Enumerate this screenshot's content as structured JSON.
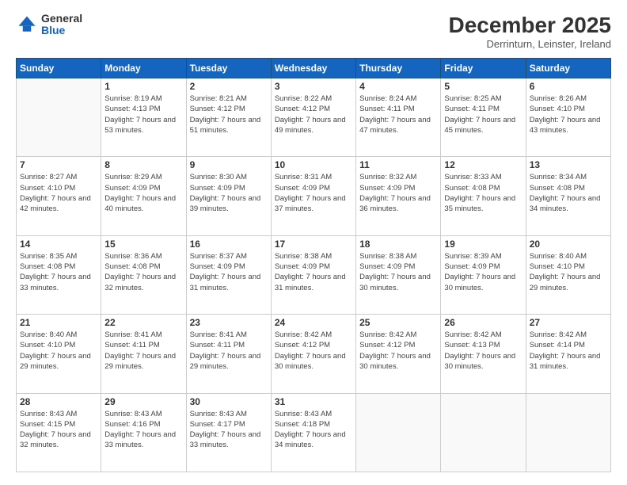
{
  "logo": {
    "general": "General",
    "blue": "Blue"
  },
  "header": {
    "title": "December 2025",
    "subtitle": "Derrinturn, Leinster, Ireland"
  },
  "weekdays": [
    "Sunday",
    "Monday",
    "Tuesday",
    "Wednesday",
    "Thursday",
    "Friday",
    "Saturday"
  ],
  "weeks": [
    [
      {
        "day": "",
        "sunrise": "",
        "sunset": "",
        "daylight": ""
      },
      {
        "day": "1",
        "sunrise": "Sunrise: 8:19 AM",
        "sunset": "Sunset: 4:13 PM",
        "daylight": "Daylight: 7 hours and 53 minutes."
      },
      {
        "day": "2",
        "sunrise": "Sunrise: 8:21 AM",
        "sunset": "Sunset: 4:12 PM",
        "daylight": "Daylight: 7 hours and 51 minutes."
      },
      {
        "day": "3",
        "sunrise": "Sunrise: 8:22 AM",
        "sunset": "Sunset: 4:12 PM",
        "daylight": "Daylight: 7 hours and 49 minutes."
      },
      {
        "day": "4",
        "sunrise": "Sunrise: 8:24 AM",
        "sunset": "Sunset: 4:11 PM",
        "daylight": "Daylight: 7 hours and 47 minutes."
      },
      {
        "day": "5",
        "sunrise": "Sunrise: 8:25 AM",
        "sunset": "Sunset: 4:11 PM",
        "daylight": "Daylight: 7 hours and 45 minutes."
      },
      {
        "day": "6",
        "sunrise": "Sunrise: 8:26 AM",
        "sunset": "Sunset: 4:10 PM",
        "daylight": "Daylight: 7 hours and 43 minutes."
      }
    ],
    [
      {
        "day": "7",
        "sunrise": "Sunrise: 8:27 AM",
        "sunset": "Sunset: 4:10 PM",
        "daylight": "Daylight: 7 hours and 42 minutes."
      },
      {
        "day": "8",
        "sunrise": "Sunrise: 8:29 AM",
        "sunset": "Sunset: 4:09 PM",
        "daylight": "Daylight: 7 hours and 40 minutes."
      },
      {
        "day": "9",
        "sunrise": "Sunrise: 8:30 AM",
        "sunset": "Sunset: 4:09 PM",
        "daylight": "Daylight: 7 hours and 39 minutes."
      },
      {
        "day": "10",
        "sunrise": "Sunrise: 8:31 AM",
        "sunset": "Sunset: 4:09 PM",
        "daylight": "Daylight: 7 hours and 37 minutes."
      },
      {
        "day": "11",
        "sunrise": "Sunrise: 8:32 AM",
        "sunset": "Sunset: 4:09 PM",
        "daylight": "Daylight: 7 hours and 36 minutes."
      },
      {
        "day": "12",
        "sunrise": "Sunrise: 8:33 AM",
        "sunset": "Sunset: 4:08 PM",
        "daylight": "Daylight: 7 hours and 35 minutes."
      },
      {
        "day": "13",
        "sunrise": "Sunrise: 8:34 AM",
        "sunset": "Sunset: 4:08 PM",
        "daylight": "Daylight: 7 hours and 34 minutes."
      }
    ],
    [
      {
        "day": "14",
        "sunrise": "Sunrise: 8:35 AM",
        "sunset": "Sunset: 4:08 PM",
        "daylight": "Daylight: 7 hours and 33 minutes."
      },
      {
        "day": "15",
        "sunrise": "Sunrise: 8:36 AM",
        "sunset": "Sunset: 4:08 PM",
        "daylight": "Daylight: 7 hours and 32 minutes."
      },
      {
        "day": "16",
        "sunrise": "Sunrise: 8:37 AM",
        "sunset": "Sunset: 4:09 PM",
        "daylight": "Daylight: 7 hours and 31 minutes."
      },
      {
        "day": "17",
        "sunrise": "Sunrise: 8:38 AM",
        "sunset": "Sunset: 4:09 PM",
        "daylight": "Daylight: 7 hours and 31 minutes."
      },
      {
        "day": "18",
        "sunrise": "Sunrise: 8:38 AM",
        "sunset": "Sunset: 4:09 PM",
        "daylight": "Daylight: 7 hours and 30 minutes."
      },
      {
        "day": "19",
        "sunrise": "Sunrise: 8:39 AM",
        "sunset": "Sunset: 4:09 PM",
        "daylight": "Daylight: 7 hours and 30 minutes."
      },
      {
        "day": "20",
        "sunrise": "Sunrise: 8:40 AM",
        "sunset": "Sunset: 4:10 PM",
        "daylight": "Daylight: 7 hours and 29 minutes."
      }
    ],
    [
      {
        "day": "21",
        "sunrise": "Sunrise: 8:40 AM",
        "sunset": "Sunset: 4:10 PM",
        "daylight": "Daylight: 7 hours and 29 minutes."
      },
      {
        "day": "22",
        "sunrise": "Sunrise: 8:41 AM",
        "sunset": "Sunset: 4:11 PM",
        "daylight": "Daylight: 7 hours and 29 minutes."
      },
      {
        "day": "23",
        "sunrise": "Sunrise: 8:41 AM",
        "sunset": "Sunset: 4:11 PM",
        "daylight": "Daylight: 7 hours and 29 minutes."
      },
      {
        "day": "24",
        "sunrise": "Sunrise: 8:42 AM",
        "sunset": "Sunset: 4:12 PM",
        "daylight": "Daylight: 7 hours and 30 minutes."
      },
      {
        "day": "25",
        "sunrise": "Sunrise: 8:42 AM",
        "sunset": "Sunset: 4:12 PM",
        "daylight": "Daylight: 7 hours and 30 minutes."
      },
      {
        "day": "26",
        "sunrise": "Sunrise: 8:42 AM",
        "sunset": "Sunset: 4:13 PM",
        "daylight": "Daylight: 7 hours and 30 minutes."
      },
      {
        "day": "27",
        "sunrise": "Sunrise: 8:42 AM",
        "sunset": "Sunset: 4:14 PM",
        "daylight": "Daylight: 7 hours and 31 minutes."
      }
    ],
    [
      {
        "day": "28",
        "sunrise": "Sunrise: 8:43 AM",
        "sunset": "Sunset: 4:15 PM",
        "daylight": "Daylight: 7 hours and 32 minutes."
      },
      {
        "day": "29",
        "sunrise": "Sunrise: 8:43 AM",
        "sunset": "Sunset: 4:16 PM",
        "daylight": "Daylight: 7 hours and 33 minutes."
      },
      {
        "day": "30",
        "sunrise": "Sunrise: 8:43 AM",
        "sunset": "Sunset: 4:17 PM",
        "daylight": "Daylight: 7 hours and 33 minutes."
      },
      {
        "day": "31",
        "sunrise": "Sunrise: 8:43 AM",
        "sunset": "Sunset: 4:18 PM",
        "daylight": "Daylight: 7 hours and 34 minutes."
      },
      {
        "day": "",
        "sunrise": "",
        "sunset": "",
        "daylight": ""
      },
      {
        "day": "",
        "sunrise": "",
        "sunset": "",
        "daylight": ""
      },
      {
        "day": "",
        "sunrise": "",
        "sunset": "",
        "daylight": ""
      }
    ]
  ]
}
